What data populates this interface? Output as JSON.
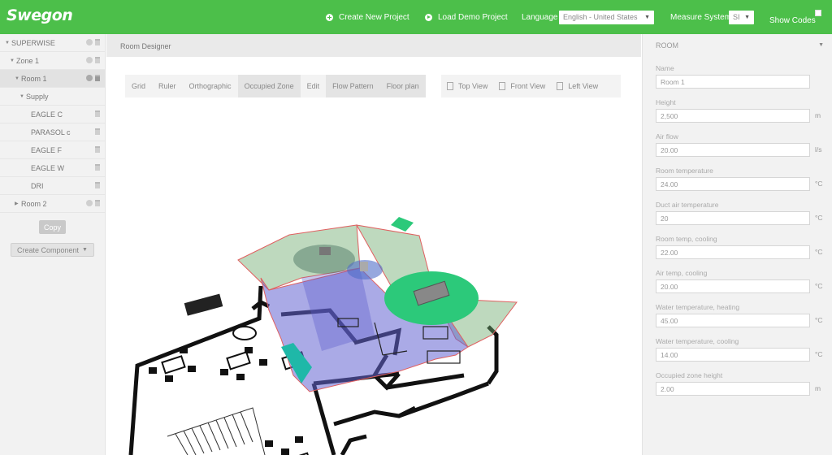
{
  "topbar": {
    "logo": "Swegon",
    "create_project": "Create New Project",
    "load_demo": "Load Demo Project",
    "language_label": "Language",
    "language_value": "English - United States",
    "measure_label": "Measure System",
    "measure_value": "SI",
    "show_codes": "Show Codes",
    "accent_color": "#4cbf4a"
  },
  "tree": {
    "items": [
      {
        "label": "SUPERWISE"
      },
      {
        "label": "Zone 1"
      },
      {
        "label": "Room 1"
      },
      {
        "label": "Supply"
      },
      {
        "label": "EAGLE C"
      },
      {
        "label": "PARASOL c"
      },
      {
        "label": "EAGLE F"
      },
      {
        "label": "EAGLE W"
      },
      {
        "label": "DRI"
      },
      {
        "label": "Room 2"
      }
    ],
    "copy_label": "Copy",
    "create_component_label": "Create Component"
  },
  "designer": {
    "title": "Room Designer",
    "tools": [
      "Grid",
      "Ruler",
      "Orthographic",
      "Occupied Zone",
      "Edit",
      "Flow Pattern",
      "Floor plan"
    ],
    "views": [
      "Top View",
      "Front View",
      "Left View"
    ]
  },
  "room": {
    "title": "ROOM",
    "fields": [
      {
        "label": "Name",
        "value": "Room 1",
        "unit": ""
      },
      {
        "label": "Height",
        "value": "2,500",
        "unit": "m"
      },
      {
        "label": "Air flow",
        "value": "20.00",
        "unit": "l/s"
      },
      {
        "label": "Room temperature",
        "value": "24.00",
        "unit": "°C"
      },
      {
        "label": "Duct air temperature",
        "value": "20",
        "unit": "°C"
      },
      {
        "label": "Room temp, cooling",
        "value": "22.00",
        "unit": "°C"
      },
      {
        "label": "Air temp, cooling",
        "value": "20.00",
        "unit": "°C"
      },
      {
        "label": "Water temperature, heating",
        "value": "45.00",
        "unit": "°C"
      },
      {
        "label": "Water temperature, cooling",
        "value": "14.00",
        "unit": "°C"
      },
      {
        "label": "Occupied zone height",
        "value": "2.00",
        "unit": "m"
      }
    ]
  }
}
